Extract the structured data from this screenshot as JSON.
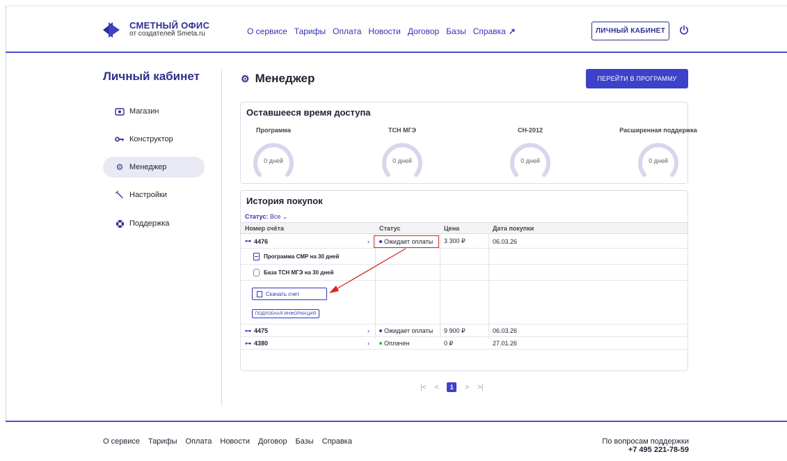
{
  "brand": {
    "title": "СМЕТНЫЙ ОФИС",
    "subtitle": "от создателей Smeta.ru",
    "color": "#2d2f8f"
  },
  "header": {
    "nav": [
      "О сервисе",
      "Тарифы",
      "Оплата",
      "Новости",
      "Договор",
      "Базы",
      "Справка"
    ],
    "cabinet_button": "ЛИЧНЫЙ КАБИНЕТ",
    "power_icon": "power-icon"
  },
  "sidebar": {
    "title": "Личный кабинет",
    "items": [
      {
        "label": "Магазин",
        "icon": "shop-icon"
      },
      {
        "label": "Конструктор",
        "icon": "key-icon"
      },
      {
        "label": "Менеджер",
        "icon": "gear-icon",
        "active": true
      },
      {
        "label": "Настройки",
        "icon": "wrench-icon"
      },
      {
        "label": "Поддержка",
        "icon": "lifebuoy-icon"
      }
    ]
  },
  "main": {
    "title": "Менеджер",
    "go_button": "ПЕРЕЙТИ В ПРОГРАММУ",
    "access": {
      "title": "Оставшееся время доступа",
      "gauges": [
        {
          "label": "Программа",
          "value": "0 дней"
        },
        {
          "label": "ТСН МГЭ",
          "value": "0 дней"
        },
        {
          "label": "СН-2012",
          "value": "0 дней"
        },
        {
          "label": "Расширенная поддержка",
          "value": "0 дней"
        }
      ]
    },
    "history": {
      "title": "История покупок",
      "filter_label": "Статус:",
      "filter_value": "Все",
      "columns": [
        "Номер счёта",
        "Статус",
        "Цена",
        "Дата покупки"
      ],
      "orders": [
        {
          "number": "4476",
          "status": "Ожидает оплаты",
          "price": "3 300 ₽",
          "date": "06.03.26",
          "status_color": "#3134b5"
        },
        {
          "number": "4475",
          "status": "Ожидает оплаты",
          "price": "9 900 ₽",
          "date": "06.03.26",
          "status_color": "#3134b5"
        },
        {
          "number": "4380",
          "status": "Оплачен",
          "price": "0 ₽",
          "date": "27.01.26",
          "status_color": "#2bb36a"
        }
      ],
      "expanded_items": [
        "Программа СМР на 30 дней",
        "База ТСН МГЭ на 30 дней"
      ],
      "download_button": "Скачать счет",
      "info_button": "ПОДРОБНАЯ ИНФОРМАЦИЯ"
    },
    "pager": {
      "first": "|<",
      "prev": "<",
      "current": "1",
      "next": ">",
      "last": ">|"
    }
  },
  "footer": {
    "nav": [
      "О сервисе",
      "Тарифы",
      "Оплата",
      "Новости",
      "Договор",
      "Базы",
      "Справка"
    ],
    "support_text": "По вопросам поддержки",
    "support_phone": "+7 495 221-78-59"
  },
  "colors": {
    "accent": "#3e41c9",
    "annotation": "#d7262b"
  }
}
